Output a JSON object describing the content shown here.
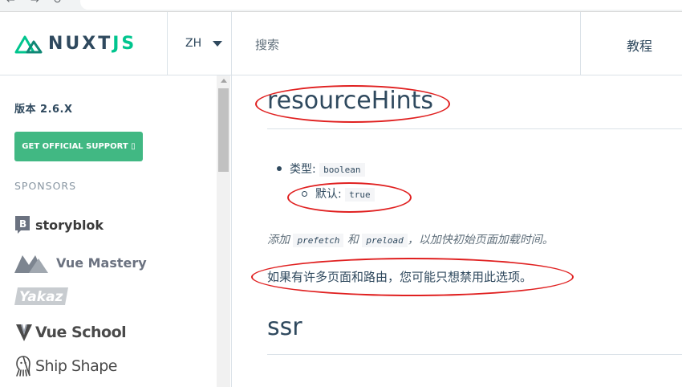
{
  "header": {
    "logo": {
      "text_main": "NUXT",
      "text_accent": "JS"
    },
    "language": "ZH",
    "search_placeholder": "搜索",
    "nav_tutorial": "教程"
  },
  "sidebar": {
    "version": "版本 2.6.X",
    "support_button": "GET OFFICIAL SUPPORT ▯",
    "sponsors_heading": "SPONSORS",
    "sponsors": [
      {
        "name": "storyblok",
        "icon": "storyblok-logo"
      },
      {
        "name": "Vue Mastery",
        "icon": "vue-mastery-logo"
      },
      {
        "name": "Yakaz",
        "icon": "yakaz-logo"
      },
      {
        "name": "Vue School",
        "icon": "vue-school-logo"
      },
      {
        "name": "Ship Shape",
        "icon": "ship-shape-logo"
      }
    ]
  },
  "content": {
    "heading1": "resourceHints",
    "type_label": "类型:",
    "type_value": "boolean",
    "default_label": "默认:",
    "default_value": "true",
    "desc_prefix": "添加",
    "desc_code1": "prefetch",
    "desc_and": "和",
    "desc_code2": "preload",
    "desc_suffix": "，以加快初始页面加载时间。",
    "note": "如果有许多页面和路由，您可能只想禁用此选项。",
    "heading2": "ssr"
  },
  "colors": {
    "brand_green": "#00c58e",
    "button_green": "#41b883",
    "text_dark": "#2f495e",
    "annotation_red": "#e02020"
  }
}
